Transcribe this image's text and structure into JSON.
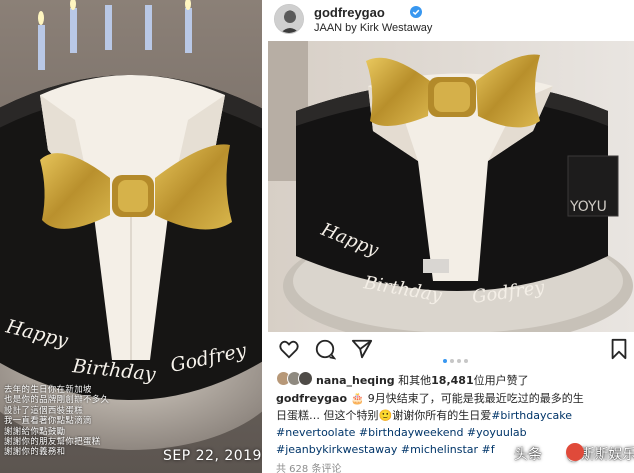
{
  "story": {
    "caption_lines": [
      "去年的生日你在新加坡",
      "也是你的品牌剛創辦不多久",
      "設計了這個西裝蛋糕",
      "我一直看著你點點滴滴",
      "謝謝給你點鼓勵",
      "謝謝你的朋友幫你把蛋糕",
      "謝謝你的義務和"
    ],
    "date": "SEP 22, 2019",
    "cake_text": "Happy Birthday Godfrey"
  },
  "post": {
    "username": "godfreygao",
    "location": "JAAN by Kirk Westaway",
    "cake_text": "Happy Birthday Godfrey",
    "box_text": "YOYU",
    "carousel_active_index": 0,
    "carousel_count": 4,
    "likes": {
      "first_user": "nana_heqing",
      "middle": "和其他",
      "count": "18,481",
      "suffix": "位用户赞了"
    },
    "caption": {
      "user": "godfreygao",
      "emoji_cake": "🎂",
      "line1": "9月快结束了，可能是我最近吃过的最多的生",
      "line2_a": "日蛋糕… 但这个特别",
      "line2_emoji": "🙂",
      "line2_b": "谢谢你所有的生日爱",
      "line2_tag": "#birthdaycake",
      "line3": "#nevertoolate #birthdayweekend #yoyuulab",
      "line4": "#jeanbykirkwestaway #michelinstar #f"
    },
    "comments": "共 628 条评论"
  },
  "watermark": {
    "prefix": "头条",
    "handle": "@斯斯娱乐"
  },
  "colors": {
    "link": "#003569",
    "carousel_active": "#3897f0",
    "verified": "#3897f0",
    "bowtie": "#c9a23a"
  }
}
